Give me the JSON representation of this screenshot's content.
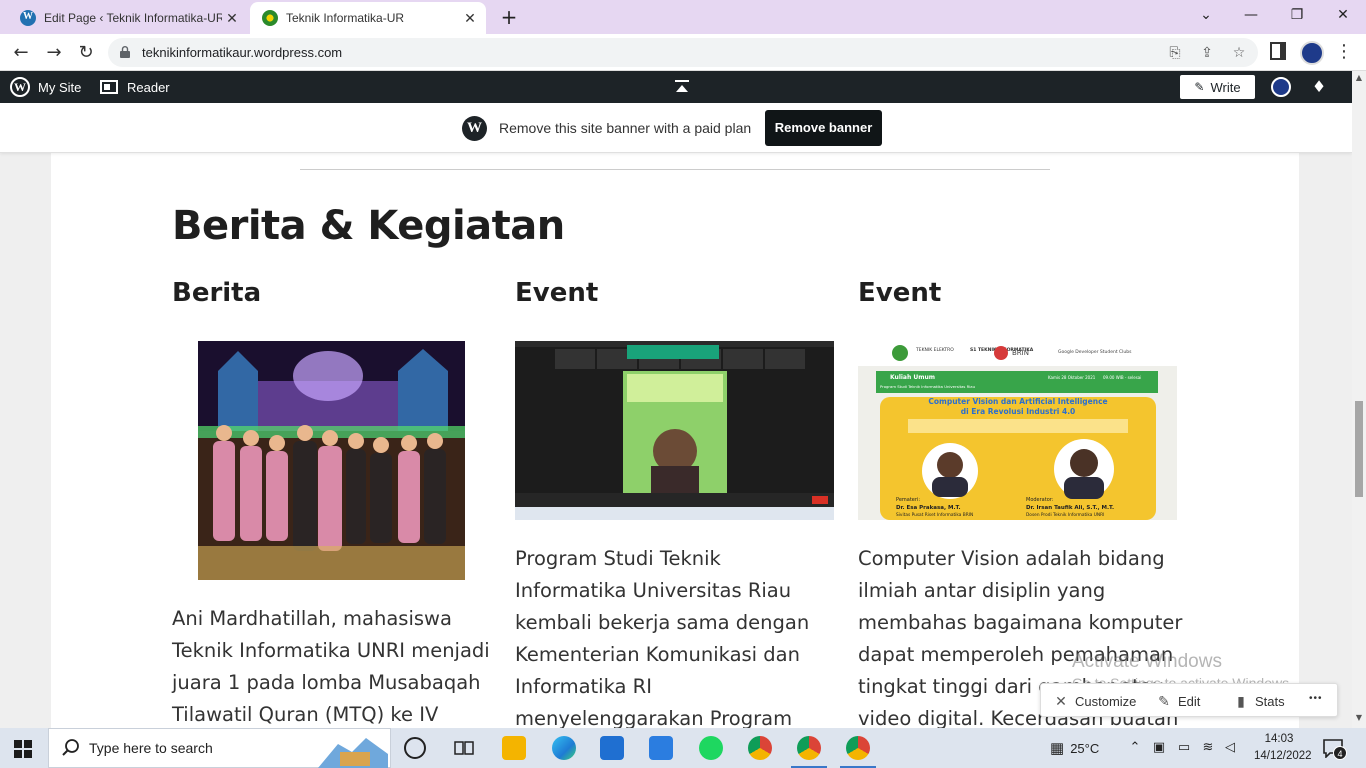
{
  "browser": {
    "tabs": [
      {
        "title": "Edit Page ‹ Teknik Informatika-UR",
        "close": "✕"
      },
      {
        "title": "Teknik Informatika-UR",
        "close": "✕"
      }
    ],
    "new_tab": "+",
    "url": "teknikinformatikaur.wordpress.com",
    "window_controls": {
      "dropdown": "⌄",
      "minimize": "—",
      "restore": "❐",
      "close": "✕"
    }
  },
  "wp_admin_bar": {
    "my_site": "My Site",
    "reader": "Reader",
    "write": "Write"
  },
  "banner": {
    "text": "Remove this site banner with a paid plan",
    "button": "Remove banner"
  },
  "main": {
    "section_title": "Berita & Kegiatan",
    "columns": [
      {
        "heading": "Berita",
        "text": "Ani Mardhatillah, mahasiswa Teknik Informatika UNRI menjadi juara 1 pada lomba Musabaqah Tilawatil Quran (MTQ) ke IV"
      },
      {
        "heading": "Event",
        "text": "Program Studi Teknik Informatika Universitas Riau kembali bekerja sama dengan Kementerian Komunikasi dan Informatika RI menyelenggarakan Program Fresh Graduate"
      },
      {
        "heading": "Event",
        "text": "Computer Vision adalah bidang ilmiah antar disiplin yang membahas bagaimana komputer dapat memperoleh pemahaman tingkat tinggi dari gambar atau video digital. Kecerdasan buatan"
      }
    ],
    "event2_poster": {
      "header_left": "TEKNIK ELEKTRO",
      "header_mid": "S1 TEKNIK INFORMATIKA",
      "header_brin": "BRIN",
      "header_gdsc": "Google Developer Student Clubs",
      "kuliah": "Kuliah Umum",
      "subtitle": "Program Studi Teknik Informatika Universitas Riau",
      "date": "Kamis 28 Oktober 2021",
      "time": "09.00 WIB - selesai",
      "title_line1": "Computer Vision dan Artificial Intelligence",
      "title_line2": "di Era Revolusi Industri 4.0",
      "pemateri_label": "Pemateri:",
      "pemateri_name": "Dr. Esa Prakasa, M.T.",
      "pemateri_org": "Sivitas Pusat Riset Informatika BRIN",
      "moderator_label": "Moderator:",
      "moderator_name": "Dr. Irsan Taufik Ali, S.T., M.T.",
      "moderator_org": "Dosen Prodi Teknik Informatika UNRI"
    }
  },
  "customize_bar": {
    "customize": "Customize",
    "edit": "Edit",
    "stats": "Stats",
    "more": "•••"
  },
  "watermark": {
    "line1": "Activate Windows",
    "line2": "Go to Settings to activate Windows."
  },
  "taskbar": {
    "search_placeholder": "Type here to search",
    "temperature": "25°C",
    "time": "14:03",
    "date": "14/12/2022",
    "notifications": "4"
  }
}
